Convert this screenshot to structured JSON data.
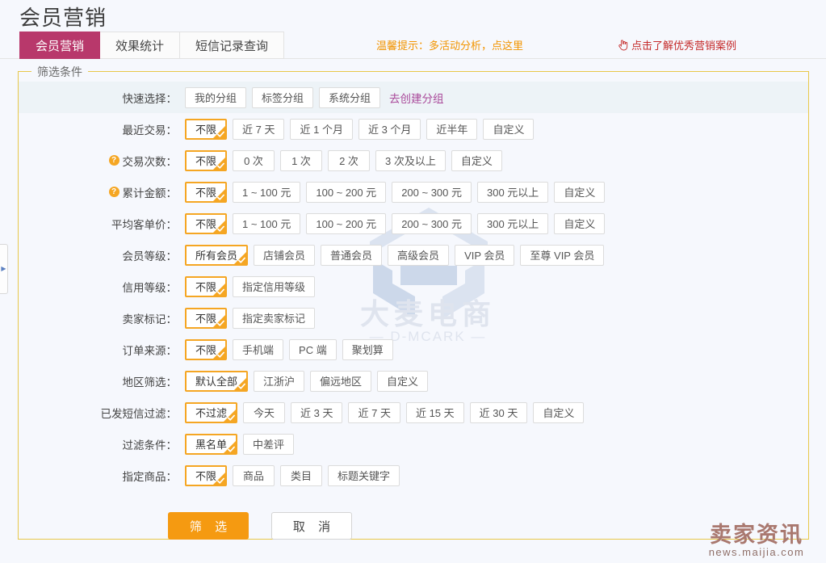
{
  "page": {
    "title": "会员营销",
    "accent_magenta": "#b8386b",
    "accent_orange": "#f5a623",
    "background": "#f6f8fd"
  },
  "tabs": [
    {
      "label": "会员营销",
      "active": true
    },
    {
      "label": "效果统计",
      "active": false
    },
    {
      "label": "短信记录查询",
      "active": false
    }
  ],
  "header": {
    "hint": "温馨提示：多活动分析，点这里",
    "case_link": "点击了解优秀营销案例",
    "hand_icon": "pointing-hand-icon"
  },
  "filter": {
    "legend": "筛选条件",
    "rows": [
      {
        "label": "快速选择：",
        "help": false,
        "shaded": true,
        "options": [
          {
            "label": "我的分组",
            "selected": false
          },
          {
            "label": "标签分组",
            "selected": false
          },
          {
            "label": "系统分组",
            "selected": false
          }
        ],
        "link": "去创建分组"
      },
      {
        "label": "最近交易：",
        "help": false,
        "shaded": false,
        "options": [
          {
            "label": "不限",
            "selected": true
          },
          {
            "label": "近 7 天",
            "selected": false
          },
          {
            "label": "近 1 个月",
            "selected": false
          },
          {
            "label": "近 3 个月",
            "selected": false
          },
          {
            "label": "近半年",
            "selected": false
          },
          {
            "label": "自定义",
            "selected": false
          }
        ]
      },
      {
        "label": "交易次数：",
        "help": true,
        "shaded": false,
        "options": [
          {
            "label": "不限",
            "selected": true
          },
          {
            "label": "0 次",
            "selected": false
          },
          {
            "label": "1 次",
            "selected": false
          },
          {
            "label": "2 次",
            "selected": false
          },
          {
            "label": "3 次及以上",
            "selected": false
          },
          {
            "label": "自定义",
            "selected": false
          }
        ]
      },
      {
        "label": "累计金额：",
        "help": true,
        "shaded": false,
        "options": [
          {
            "label": "不限",
            "selected": true
          },
          {
            "label": "1 ~ 100 元",
            "selected": false
          },
          {
            "label": "100 ~ 200 元",
            "selected": false
          },
          {
            "label": "200 ~ 300 元",
            "selected": false
          },
          {
            "label": "300 元以上",
            "selected": false
          },
          {
            "label": "自定义",
            "selected": false
          }
        ]
      },
      {
        "label": "平均客单价：",
        "help": false,
        "shaded": false,
        "options": [
          {
            "label": "不限",
            "selected": true
          },
          {
            "label": "1 ~ 100 元",
            "selected": false
          },
          {
            "label": "100 ~ 200 元",
            "selected": false
          },
          {
            "label": "200 ~ 300 元",
            "selected": false
          },
          {
            "label": "300 元以上",
            "selected": false
          },
          {
            "label": "自定义",
            "selected": false
          }
        ]
      },
      {
        "label": "会员等级：",
        "help": false,
        "shaded": false,
        "options": [
          {
            "label": "所有会员",
            "selected": true
          },
          {
            "label": "店铺会员",
            "selected": false
          },
          {
            "label": "普通会员",
            "selected": false
          },
          {
            "label": "高级会员",
            "selected": false
          },
          {
            "label": "VIP 会员",
            "selected": false
          },
          {
            "label": "至尊 VIP 会员",
            "selected": false
          }
        ]
      },
      {
        "label": "信用等级：",
        "help": false,
        "shaded": false,
        "options": [
          {
            "label": "不限",
            "selected": true
          },
          {
            "label": "指定信用等级",
            "selected": false
          }
        ]
      },
      {
        "label": "卖家标记：",
        "help": false,
        "shaded": false,
        "options": [
          {
            "label": "不限",
            "selected": true
          },
          {
            "label": "指定卖家标记",
            "selected": false
          }
        ]
      },
      {
        "label": "订单来源：",
        "help": false,
        "shaded": false,
        "options": [
          {
            "label": "不限",
            "selected": true
          },
          {
            "label": "手机端",
            "selected": false
          },
          {
            "label": "PC 端",
            "selected": false
          },
          {
            "label": "聚划算",
            "selected": false
          }
        ]
      },
      {
        "label": "地区筛选：",
        "help": false,
        "shaded": false,
        "options": [
          {
            "label": "默认全部",
            "selected": true
          },
          {
            "label": "江浙沪",
            "selected": false
          },
          {
            "label": "偏远地区",
            "selected": false
          },
          {
            "label": "自定义",
            "selected": false
          }
        ]
      },
      {
        "label": "已发短信过滤：",
        "help": false,
        "shaded": false,
        "options": [
          {
            "label": "不过滤",
            "selected": true
          },
          {
            "label": "今天",
            "selected": false
          },
          {
            "label": "近 3 天",
            "selected": false
          },
          {
            "label": "近 7 天",
            "selected": false
          },
          {
            "label": "近 15 天",
            "selected": false
          },
          {
            "label": "近 30 天",
            "selected": false
          },
          {
            "label": "自定义",
            "selected": false
          }
        ]
      },
      {
        "label": "过滤条件：",
        "help": false,
        "shaded": false,
        "options": [
          {
            "label": "黑名单",
            "selected": true
          },
          {
            "label": "中差评",
            "selected": false
          }
        ]
      },
      {
        "label": "指定商品：",
        "help": false,
        "shaded": false,
        "options": [
          {
            "label": "不限",
            "selected": true
          },
          {
            "label": "商品",
            "selected": false
          },
          {
            "label": "类目",
            "selected": false
          },
          {
            "label": "标题关键字",
            "selected": false
          }
        ]
      }
    ]
  },
  "actions": {
    "submit": "筛 选",
    "cancel": "取 消"
  },
  "watermark": {
    "main": "大麦电商",
    "sub": "— D-MCARK —"
  },
  "site_logo": {
    "name": "卖家资讯",
    "url": "news.maijia.com"
  },
  "sidebar_handle": {
    "icon": "collapse-arrow-icon"
  }
}
